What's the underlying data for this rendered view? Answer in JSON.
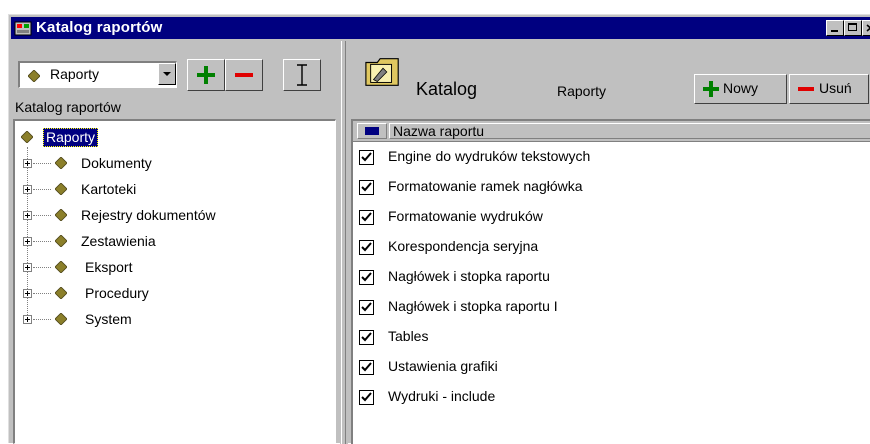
{
  "window": {
    "title": "Katalog raportów"
  },
  "left": {
    "combo_value": "Raporty",
    "panel_label": "Katalog raportów",
    "tree": {
      "root": "Raporty",
      "children": [
        "Dokumenty",
        "Kartoteki",
        "Rejestry dokumentów",
        "Zestawienia",
        "Eksport",
        "Procedury",
        "System"
      ]
    }
  },
  "right": {
    "title": "Katalog",
    "subtitle": "Raporty",
    "new_label": "Nowy",
    "delete_label": "Usuń",
    "column_header": "Nazwa raportu",
    "items": [
      "Engine do wydruków tekstowych",
      "Formatowanie ramek nagłówka",
      "Formatowanie wydruków",
      "Korespondencja seryjna",
      "Nagłówek i stopka raportu",
      "Nagłówek i stopka raportu I",
      "Tables",
      "Ustawienia grafiki",
      "Wydruki - include"
    ]
  },
  "colors": {
    "titlebar": "#000080",
    "face": "#c0c0c0",
    "add": "#008000",
    "remove": "#e00000",
    "diamond": "#8b7f2a"
  }
}
